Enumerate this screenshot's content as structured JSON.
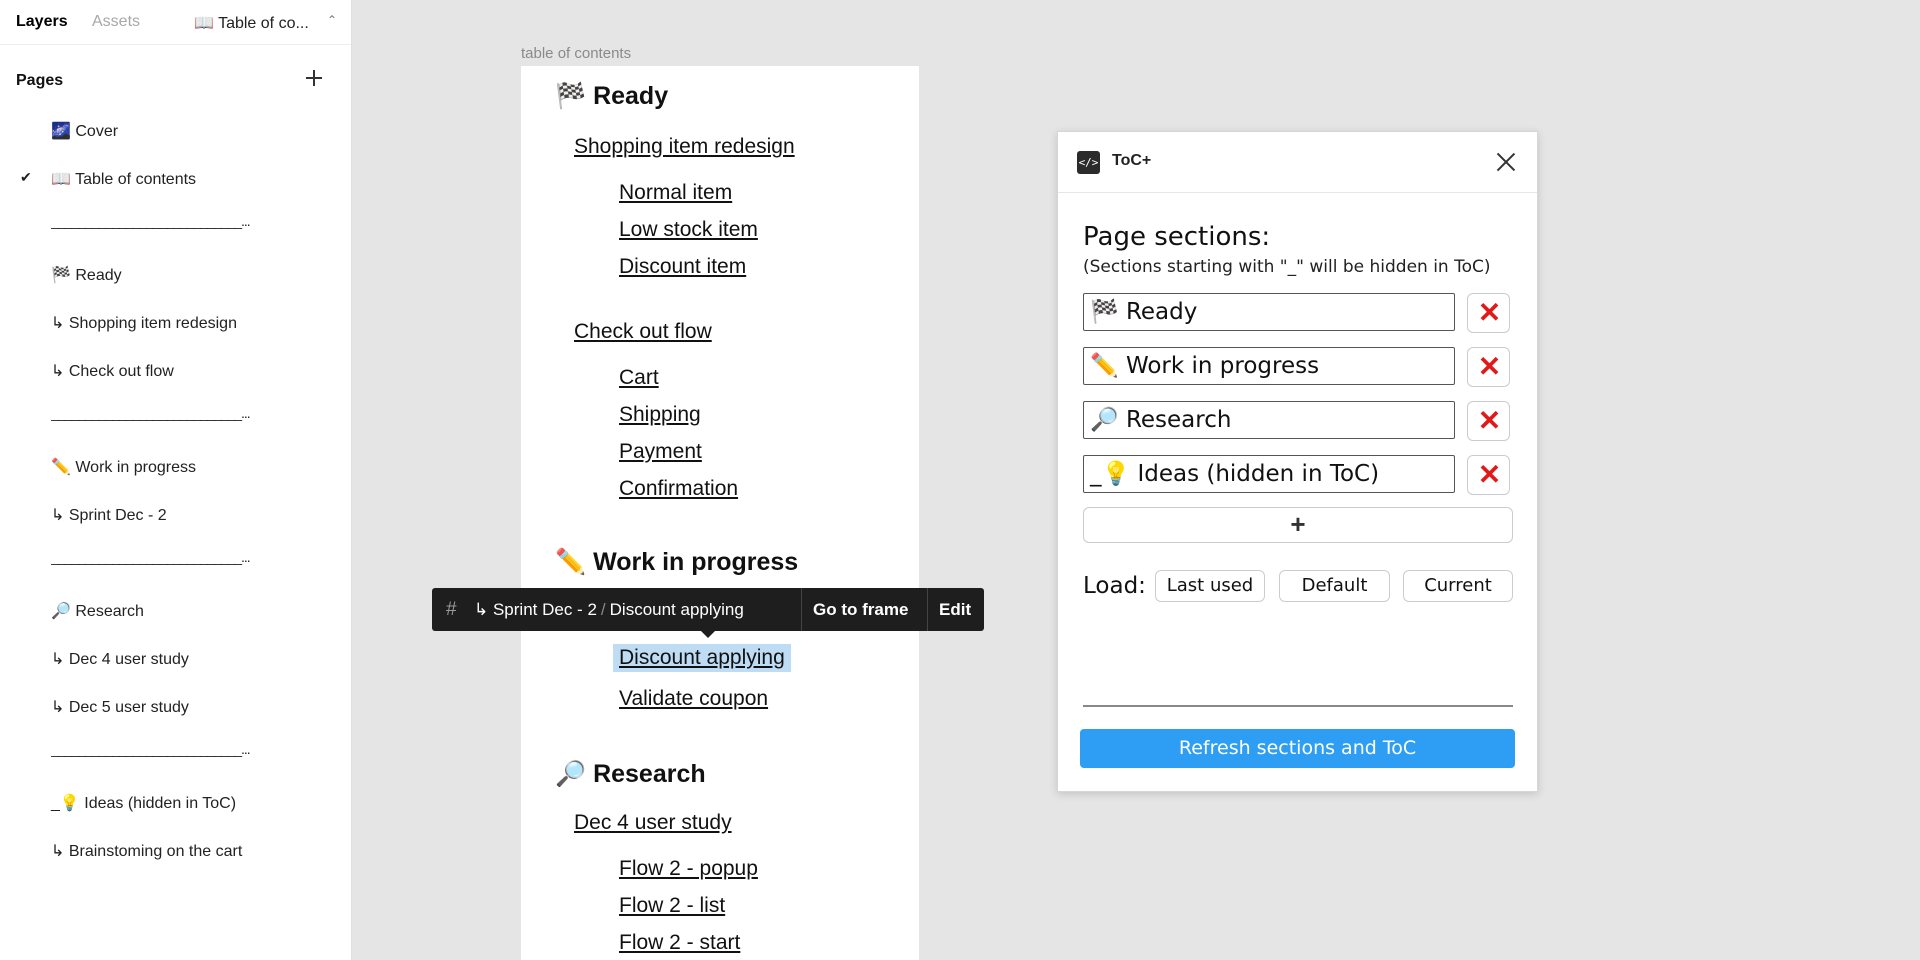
{
  "left_panel": {
    "tabs": {
      "layers": "Layers",
      "assets": "Assets",
      "current_page": "📖 Table of co..."
    },
    "pages_header": "Pages",
    "pages": [
      {
        "label": "🌌 Cover",
        "selected": false,
        "type": "page"
      },
      {
        "label": "📖 Table of contents",
        "selected": true,
        "type": "page"
      },
      {
        "label": "____________________________...",
        "selected": false,
        "type": "divider"
      },
      {
        "label": "🏁 Ready",
        "selected": false,
        "type": "page"
      },
      {
        "label": "↳ Shopping item redesign",
        "selected": false,
        "type": "page"
      },
      {
        "label": "↳ Check out flow",
        "selected": false,
        "type": "page"
      },
      {
        "label": "____________________________...",
        "selected": false,
        "type": "divider"
      },
      {
        "label": "✏️ Work in progress",
        "selected": false,
        "type": "page"
      },
      {
        "label": "↳ Sprint Dec - 2",
        "selected": false,
        "type": "page"
      },
      {
        "label": "____________________________...",
        "selected": false,
        "type": "divider"
      },
      {
        "label": "🔎 Research",
        "selected": false,
        "type": "page"
      },
      {
        "label": "↳ Dec 4 user study",
        "selected": false,
        "type": "page"
      },
      {
        "label": "↳ Dec 5 user study",
        "selected": false,
        "type": "page"
      },
      {
        "label": "____________________________...",
        "selected": false,
        "type": "divider"
      },
      {
        "label": "_💡 Ideas (hidden in ToC)",
        "selected": false,
        "type": "page"
      },
      {
        "label": "↳ Brainstoming on the cart",
        "selected": false,
        "type": "page"
      }
    ],
    "check_mark": "✔"
  },
  "canvas": {
    "frame_title": "table of contents",
    "toc": {
      "h_ready": "🏁 Ready",
      "sub_shopping": "Shopping item redesign",
      "normal_item": "Normal item",
      "low_stock_item": "Low stock item",
      "discount_item": "Discount item",
      "sub_checkout": "Check out flow",
      "cart": "Cart",
      "shipping": "Shipping",
      "payment": "Payment",
      "confirmation": "Confirmation",
      "h_wip": "✏️ Work in progress",
      "discount_applying": "Discount applying",
      "validate_coupon": "Validate coupon",
      "h_research": "🔎 Research",
      "sub_dec4": "Dec 4 user study",
      "flow2_popup": "Flow 2 - popup",
      "flow2_list": "Flow 2 - list",
      "flow2_start": "Flow 2 - start"
    },
    "toolbar": {
      "hash": "#",
      "crumb_parent": "↳ Sprint Dec - 2",
      "crumb_sep": "/",
      "crumb_child": "Discount applying",
      "goto": "Go to frame",
      "edit": "Edit"
    }
  },
  "plugin": {
    "icon_text": "</>",
    "title": "ToC+",
    "sections_title": "Page sections:",
    "sections_note": "(Sections starting with \"_\" will be hidden in ToC)",
    "sections": [
      {
        "value": "🏁 Ready"
      },
      {
        "value": "✏️ Work in progress"
      },
      {
        "value": "🔎 Research"
      },
      {
        "value": "_💡 Ideas (hidden in ToC)"
      }
    ],
    "delete_glyph": "✕",
    "add_glyph": "+",
    "load_label": "Load:",
    "load_buttons": [
      "Last used",
      "Default",
      "Current"
    ],
    "refresh_label": "Refresh sections and ToC",
    "accent_color": "#2d9ef3",
    "delete_color": "#e01919"
  }
}
